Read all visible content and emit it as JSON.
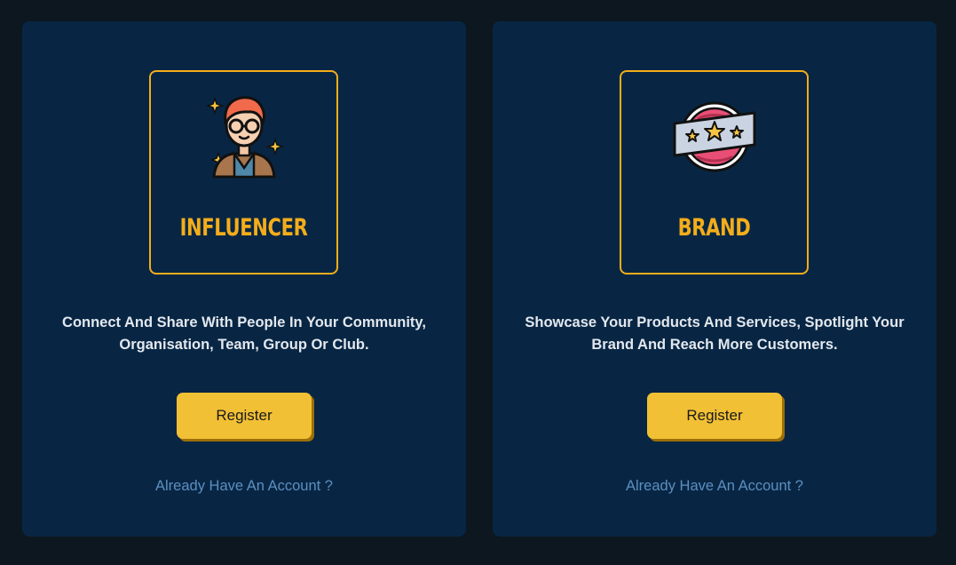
{
  "colors": {
    "page_background": "#0c171f",
    "card_background": "#082644",
    "accent": "#f4ad1a",
    "button": "#f2c035",
    "link": "#5c8fc0"
  },
  "cards": [
    {
      "icon": "influencer-person-icon",
      "title": "INFLUENCER",
      "description": "Connect And Share With People In Your Community, Organisation, Team, Group Or Club.",
      "register_label": "Register",
      "login_link": "Already Have An Account ?"
    },
    {
      "icon": "brand-badge-icon",
      "title": "BRAND",
      "description": "Showcase Your Products And Services, Spotlight Your Brand And Reach More Customers.",
      "register_label": "Register",
      "login_link": "Already Have An Account ?"
    }
  ]
}
